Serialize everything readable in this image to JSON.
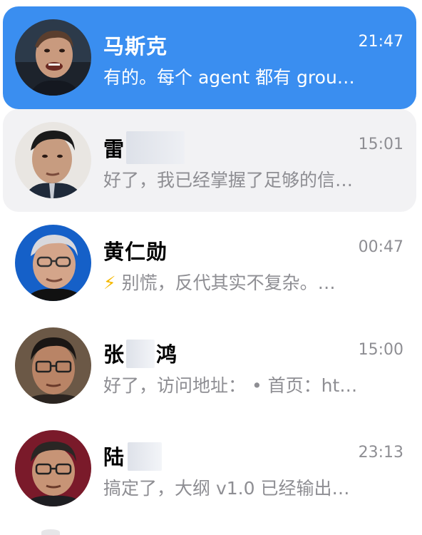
{
  "chats": [
    {
      "name": "马斯克",
      "time": "21:47",
      "preview": "有的。每个 agent 都有 grou…",
      "state": "active",
      "avatar": "avatar-musk"
    },
    {
      "name": "雷",
      "time": "15:01",
      "preview": "好了，我已经掌握了足够的信…",
      "state": "hover",
      "avatar": "avatar-lei"
    },
    {
      "name": "黄仁勋",
      "time": "00:47",
      "icon": "lightning-icon",
      "preview": "别慌，反代其实不复杂。…",
      "state": "normal",
      "avatar": "avatar-huang"
    },
    {
      "name_a": "张",
      "name_b": "鸿",
      "time": "15:00",
      "preview": "好了，访问地址：  • 首页：ht…",
      "state": "normal",
      "avatar": "avatar-zhang"
    },
    {
      "name": "陆",
      "time": "23:13",
      "preview": "搞定了，大纲 v1.0 已经输出…",
      "state": "normal",
      "avatar": "avatar-lu"
    }
  ],
  "colors": {
    "active_bg": "#3a8ef0",
    "hover_bg": "#f2f2f4",
    "secondary_text": "#8e8e93",
    "bolt": "#f5b800"
  }
}
